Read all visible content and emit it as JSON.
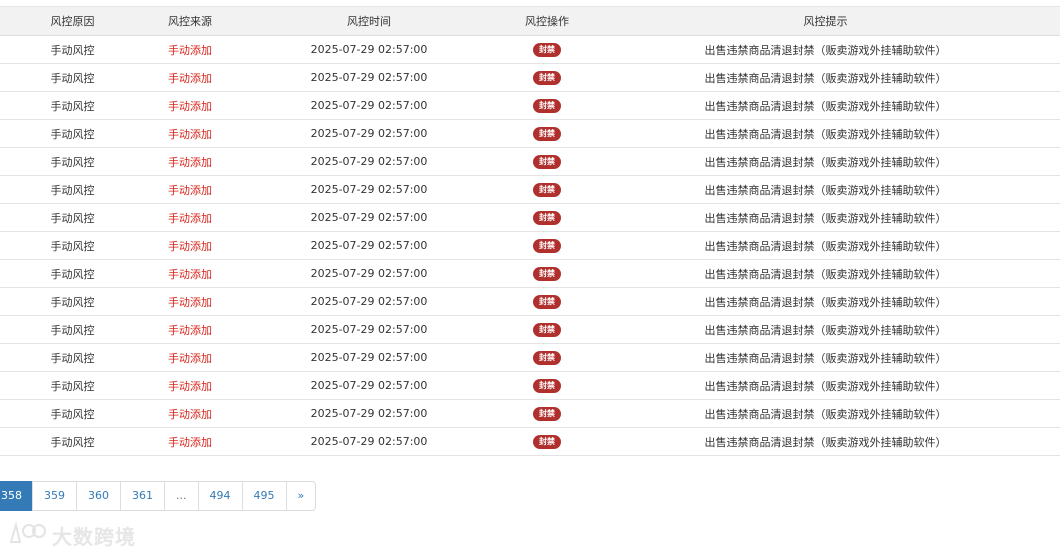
{
  "headers": [
    "风控原因",
    "风控来源",
    "风控时间",
    "风控操作",
    "风控提示"
  ],
  "rows": [
    {
      "reason": "手动风控",
      "source": "手动添加",
      "time": "2025-07-29 02:57:00",
      "action": "封禁",
      "tip": "出售违禁商品清退封禁（贩卖游戏外挂辅助软件）"
    },
    {
      "reason": "手动风控",
      "source": "手动添加",
      "time": "2025-07-29 02:57:00",
      "action": "封禁",
      "tip": "出售违禁商品清退封禁（贩卖游戏外挂辅助软件）"
    },
    {
      "reason": "手动风控",
      "source": "手动添加",
      "time": "2025-07-29 02:57:00",
      "action": "封禁",
      "tip": "出售违禁商品清退封禁（贩卖游戏外挂辅助软件）"
    },
    {
      "reason": "手动风控",
      "source": "手动添加",
      "time": "2025-07-29 02:57:00",
      "action": "封禁",
      "tip": "出售违禁商品清退封禁（贩卖游戏外挂辅助软件）"
    },
    {
      "reason": "手动风控",
      "source": "手动添加",
      "time": "2025-07-29 02:57:00",
      "action": "封禁",
      "tip": "出售违禁商品清退封禁（贩卖游戏外挂辅助软件）"
    },
    {
      "reason": "手动风控",
      "source": "手动添加",
      "time": "2025-07-29 02:57:00",
      "action": "封禁",
      "tip": "出售违禁商品清退封禁（贩卖游戏外挂辅助软件）"
    },
    {
      "reason": "手动风控",
      "source": "手动添加",
      "time": "2025-07-29 02:57:00",
      "action": "封禁",
      "tip": "出售违禁商品清退封禁（贩卖游戏外挂辅助软件）"
    },
    {
      "reason": "手动风控",
      "source": "手动添加",
      "time": "2025-07-29 02:57:00",
      "action": "封禁",
      "tip": "出售违禁商品清退封禁（贩卖游戏外挂辅助软件）"
    },
    {
      "reason": "手动风控",
      "source": "手动添加",
      "time": "2025-07-29 02:57:00",
      "action": "封禁",
      "tip": "出售违禁商品清退封禁（贩卖游戏外挂辅助软件）"
    },
    {
      "reason": "手动风控",
      "source": "手动添加",
      "time": "2025-07-29 02:57:00",
      "action": "封禁",
      "tip": "出售违禁商品清退封禁（贩卖游戏外挂辅助软件）"
    },
    {
      "reason": "手动风控",
      "source": "手动添加",
      "time": "2025-07-29 02:57:00",
      "action": "封禁",
      "tip": "出售违禁商品清退封禁（贩卖游戏外挂辅助软件）"
    },
    {
      "reason": "手动风控",
      "source": "手动添加",
      "time": "2025-07-29 02:57:00",
      "action": "封禁",
      "tip": "出售违禁商品清退封禁（贩卖游戏外挂辅助软件）"
    },
    {
      "reason": "手动风控",
      "source": "手动添加",
      "time": "2025-07-29 02:57:00",
      "action": "封禁",
      "tip": "出售违禁商品清退封禁（贩卖游戏外挂辅助软件）"
    },
    {
      "reason": "手动风控",
      "source": "手动添加",
      "time": "2025-07-29 02:57:00",
      "action": "封禁",
      "tip": "出售违禁商品清退封禁（贩卖游戏外挂辅助软件）"
    },
    {
      "reason": "手动风控",
      "source": "手动添加",
      "time": "2025-07-29 02:57:00",
      "action": "封禁",
      "tip": "出售违禁商品清退封禁（贩卖游戏外挂辅助软件）"
    }
  ],
  "pagination": {
    "current": "358",
    "pages": [
      "359",
      "360",
      "361"
    ],
    "ellipsis": "...",
    "tail": [
      "494",
      "495"
    ],
    "next": "»"
  },
  "watermark": {
    "text": "大数跨境",
    "icon": "brand-logo-icon"
  },
  "colors": {
    "source_red": "#d9251d",
    "badge_red": "#b0302e",
    "pager_blue": "#337ab7"
  }
}
